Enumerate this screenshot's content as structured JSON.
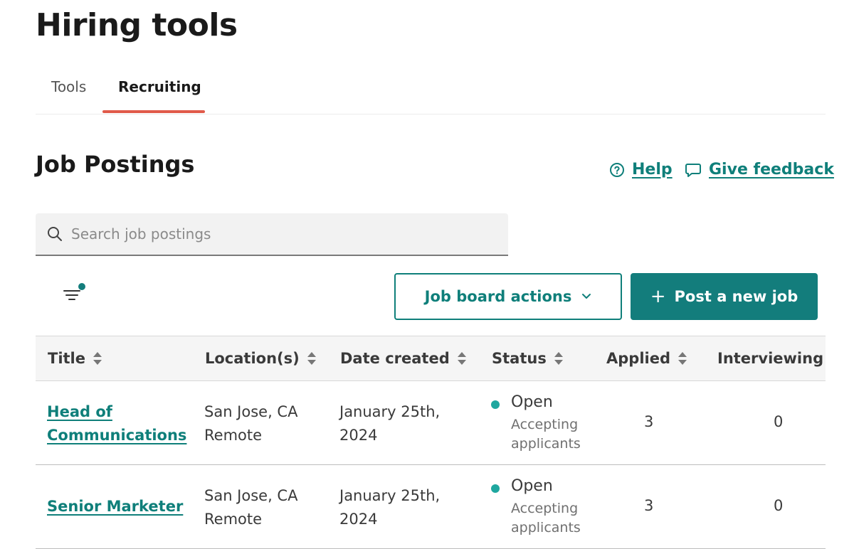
{
  "page": {
    "title": "Hiring tools"
  },
  "tabs": [
    {
      "label": "Tools",
      "active": false
    },
    {
      "label": "Recruiting",
      "active": true
    }
  ],
  "section": {
    "title": "Job Postings",
    "help_label": "Help",
    "feedback_label": "Give feedback"
  },
  "search": {
    "placeholder": "Search job postings",
    "value": ""
  },
  "actions": {
    "job_board_label": "Job board actions",
    "post_job_label": "Post a new job"
  },
  "table": {
    "columns": [
      "Title",
      "Location(s)",
      "Date created",
      "Status",
      "Applied",
      "Interviewing"
    ],
    "rows": [
      {
        "title_line1": "Head of",
        "title_line2": "Communications",
        "location_line1": "San Jose, CA",
        "location_line2": "Remote",
        "date_line1": "January 25th,",
        "date_line2": "2024",
        "status": "Open",
        "status_sub_line1": "Accepting",
        "status_sub_line2": "applicants",
        "applied": "3",
        "interviewing": "0"
      },
      {
        "title_line1": "Senior Marketer",
        "title_line2": "",
        "location_line1": "San Jose, CA",
        "location_line2": "Remote",
        "date_line1": "January 25th,",
        "date_line2": "2024",
        "status": "Open",
        "status_sub_line1": "Accepting",
        "status_sub_line2": "applicants",
        "applied": "3",
        "interviewing": "0"
      }
    ]
  },
  "colors": {
    "accent": "#0f7f7a",
    "primary_button": "#137d7c",
    "tab_indicator": "#e05a4a",
    "status_open": "#1fa79f"
  }
}
